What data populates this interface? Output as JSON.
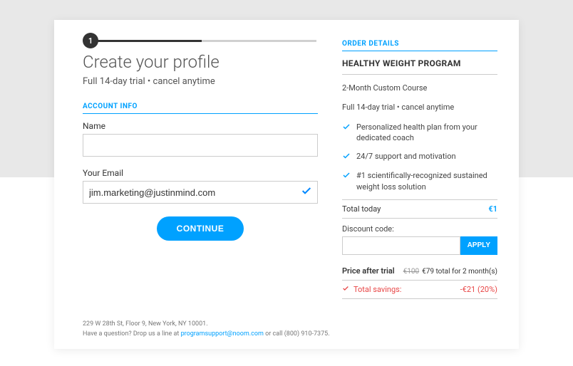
{
  "step": {
    "number": "1"
  },
  "left": {
    "title": "Create your profile",
    "subtitle": "Full 14-day trial • cancel anytime",
    "section_label": "ACCOUNT INFO",
    "name_label": "Name",
    "name_value": "",
    "email_label": "Your Email",
    "email_value": "jim.marketing@justinmind.com",
    "continue_label": "CONTINUE"
  },
  "right": {
    "heading": "ORDER DETAILS",
    "program": "HEALTHY WEIGHT PROGRAM",
    "course": "2-Month Custom Course",
    "trial": "Full 14-day trial • cancel anytime",
    "features": [
      "Personalized health plan from your dedicated coach",
      "24/7 support and motivation",
      "#1 scientifically-recognized sustained weight loss solution"
    ],
    "total_label": "Total today",
    "total_value": "€1",
    "discount_label": "Discount code:",
    "apply_label": "APPLY",
    "price_after_label": "Price after trial",
    "price_strike": "€100",
    "price_detail": "€79 total for 2 month(s)",
    "savings_label": "Total savings:",
    "savings_value": "-€21 (20%)"
  },
  "footer": {
    "line1": "229 W 28th St, Floor 9, New York, NY 10001.",
    "line2_pre": "Have a question? Drop us a line at ",
    "email": "programsupport@noom.com",
    "line2_post": " or call (800) 910-7375."
  }
}
